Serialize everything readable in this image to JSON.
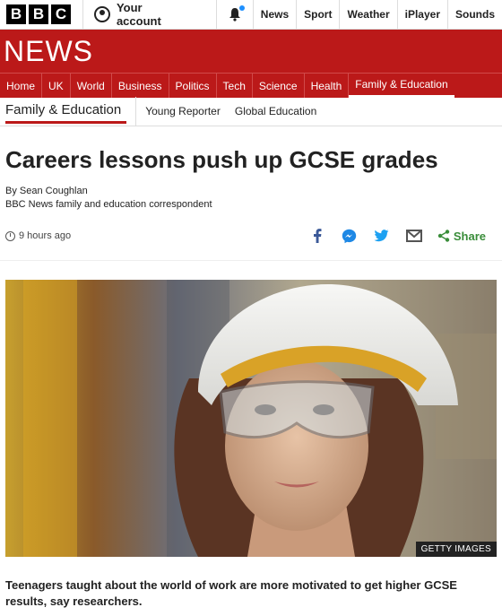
{
  "brand": {
    "logo_letters": [
      "B",
      "B",
      "C"
    ],
    "section_wordmark": "NEWS"
  },
  "account": {
    "label": "Your account"
  },
  "top_nav": [
    "News",
    "Sport",
    "Weather",
    "iPlayer",
    "Sounds"
  ],
  "red_nav": [
    "Home",
    "UK",
    "World",
    "Business",
    "Politics",
    "Tech",
    "Science",
    "Health",
    "Family & Education"
  ],
  "red_nav_active": "Family & Education",
  "sub_nav": {
    "current": "Family & Education",
    "links": [
      "Young Reporter",
      "Global Education"
    ]
  },
  "article": {
    "headline": "Careers lessons push up GCSE grades",
    "author": "By Sean Coughlan",
    "author_role": "BBC News family and education correspondent",
    "timestamp": "9 hours ago",
    "share_label": "Share",
    "image_caption": "GETTY IMAGES",
    "summary": "Teenagers taught about the world of work are more motivated to get higher GCSE results, say researchers."
  },
  "colors": {
    "brand_red": "#bb1919",
    "share_green": "#3a8d3a",
    "notification_dot": "#1e90ff"
  },
  "icons": [
    "account-icon",
    "bell-icon",
    "clock-icon",
    "facebook-icon",
    "messenger-icon",
    "twitter-icon",
    "email-icon",
    "share-icon"
  ]
}
